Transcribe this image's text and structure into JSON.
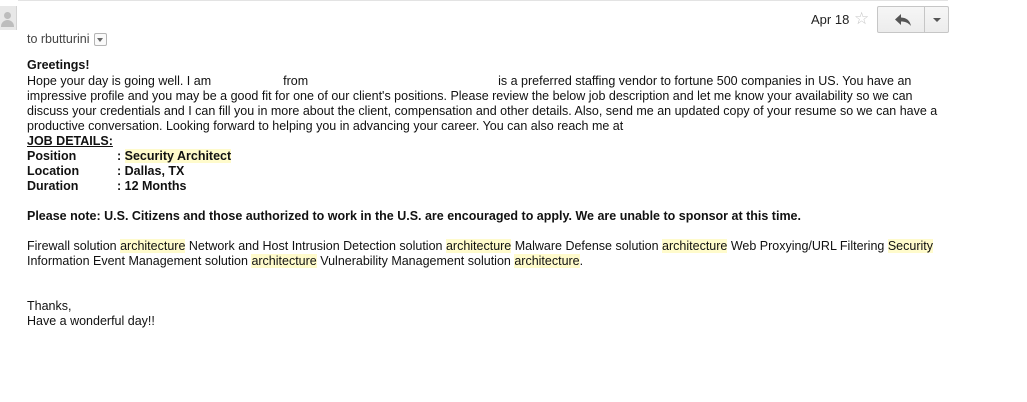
{
  "header": {
    "to_label": "to rbutturini",
    "date": "Apr 18",
    "star_glyph": "☆",
    "reply_icon": "reply-arrow-icon",
    "more_icon": "chevron-down-icon"
  },
  "email": {
    "greeting": "Greetings!",
    "p1_a": "Hope your day is going well. I am",
    "p1_b": "from",
    "p1_c": "is a preferred staffing vendor to fortune 500 companies in US.  You have an impressive profile and you may be a good fit for one of our client's positions. Please review the below job description and let me know your availability so we can discuss your credentials and I can fill you in more about the client, compensation and other details. Also, send me an updated copy of your resume so we can have a productive conversation. Looking forward to helping you in advancing your career. You can also reach me at",
    "job_details_heading": "JOB DETAILS:",
    "details": [
      {
        "key": "Position",
        "value": ": ",
        "highlight": "Security Architect"
      },
      {
        "key": "Location",
        "value": ": Dallas, TX",
        "highlight": ""
      },
      {
        "key": "Duration",
        "value": ": 12 Months",
        "highlight": ""
      }
    ],
    "note": "Please note: U.S. Citizens and those authorized to work in the U.S. are encouraged to apply. We are unable to sponsor at this time.",
    "desc": {
      "t1": "Firewall solution ",
      "h1": "architecture",
      "t2": " Network and Host Intrusion Detection solution ",
      "h2": "architecture",
      "t3": " Malware Defense solution ",
      "h3": "architecture",
      "t4": " Web Proxying/URL Filtering ",
      "h4": "Security",
      "t5": " Information Event Management solution ",
      "h5": "architecture",
      "t6": " Vulnerability Management solution ",
      "h6": "architecture",
      "t7": "."
    },
    "thanks": "Thanks,",
    "closing": "Have a wonderful day!!"
  },
  "colors": {
    "highlight": "#fffbcc",
    "text": "#111111",
    "button_border": "#c6c6c6"
  }
}
